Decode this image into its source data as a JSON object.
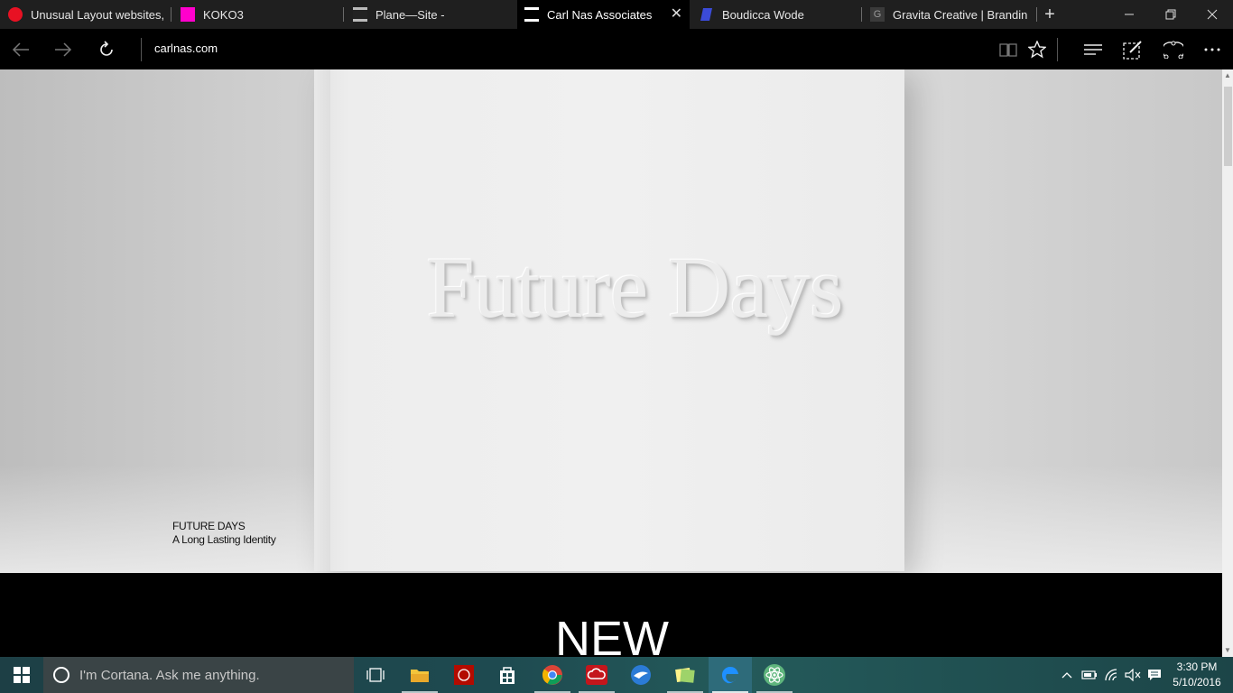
{
  "browser": {
    "tabs": [
      {
        "title": "Unusual Layout websites,",
        "favicon_color": "#e81123"
      },
      {
        "title": "KOKO3",
        "favicon_color": "#ff00cc"
      },
      {
        "title": "Plane—Site -",
        "favicon_color": "#222222"
      },
      {
        "title": "Carl Nas Associates",
        "favicon_color": "#000000",
        "active": true
      },
      {
        "title": "Boudicca Wode",
        "favicon_color": "#3b4bd8"
      },
      {
        "title": "Gravita Creative | Branding",
        "favicon_color": "#444444"
      }
    ],
    "address": "carlnas.com"
  },
  "page": {
    "hero_image_text": "Future Days",
    "caption_title": "FUTURE DAYS",
    "caption_subtitle": "A Long Lasting Identity",
    "section_heading": "NEW"
  },
  "taskbar": {
    "cortana_placeholder": "I'm Cortana. Ask me anything.",
    "apps": [
      "task-view",
      "file-explorer",
      "acrobat",
      "store",
      "chrome",
      "creative-cloud",
      "dreamweaver-bird",
      "sticky-notes",
      "edge",
      "atom"
    ],
    "time": "3:30 PM",
    "date": "5/10/2016"
  }
}
